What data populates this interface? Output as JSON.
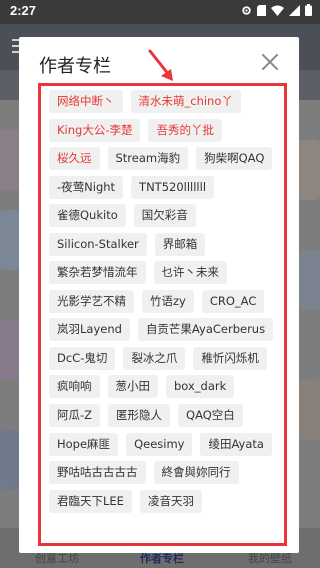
{
  "status_bar": {
    "time": "2:27"
  },
  "background": {
    "bottom_nav": [
      "创意工坊",
      "作者专栏",
      "我的壁纸"
    ],
    "active_nav": 1
  },
  "dialog": {
    "title": "作者专栏",
    "close_icon": "close-icon"
  },
  "annotation": {
    "color": "#e8343a"
  },
  "authors": [
    [
      {
        "name": "网络中断丶",
        "highlight": true
      },
      {
        "name": "清水未萌_chino丫",
        "highlight": true
      }
    ],
    [
      {
        "name": "King大公-李楚",
        "highlight": true
      },
      {
        "name": "吾秀的丫批",
        "highlight": true
      }
    ],
    [
      {
        "name": "桜久远",
        "highlight": true
      },
      {
        "name": "Stream海豹",
        "highlight": false
      },
      {
        "name": "狗柴啊QAQ",
        "highlight": false
      }
    ],
    [
      {
        "name": "-夜莺Night",
        "highlight": false
      },
      {
        "name": "TNT520lllllll",
        "highlight": false
      }
    ],
    [
      {
        "name": "雀德Qukito",
        "highlight": false
      },
      {
        "name": "国欠彩音",
        "highlight": false
      }
    ],
    [
      {
        "name": "Silicon-Stalker",
        "highlight": false
      },
      {
        "name": "界邮箱",
        "highlight": false
      }
    ],
    [
      {
        "name": "繁杂若梦惜流年",
        "highlight": false
      },
      {
        "name": "乜许丶未来",
        "highlight": false
      }
    ],
    [
      {
        "name": "光影学艺不精",
        "highlight": false
      },
      {
        "name": "竹语zy",
        "highlight": false
      },
      {
        "name": "CRO_AC",
        "highlight": false
      }
    ],
    [
      {
        "name": "岚羽Layend",
        "highlight": false
      },
      {
        "name": "自贡芒果AyaCerberus",
        "highlight": false
      }
    ],
    [
      {
        "name": "DcC-鬼切",
        "highlight": false
      },
      {
        "name": "裂冰之爪",
        "highlight": false
      },
      {
        "name": "稚忻闪烁机",
        "highlight": false
      }
    ],
    [
      {
        "name": "疯响响",
        "highlight": false
      },
      {
        "name": "葱小田",
        "highlight": false
      },
      {
        "name": "box_dark",
        "highlight": false
      }
    ],
    [
      {
        "name": "阿瓜-Z",
        "highlight": false
      },
      {
        "name": "匿形隐人",
        "highlight": false
      },
      {
        "name": "QAQ空白",
        "highlight": false
      }
    ],
    [
      {
        "name": "Hope麻匪",
        "highlight": false
      },
      {
        "name": "Qeesimy",
        "highlight": false
      },
      {
        "name": "绫田Ayata",
        "highlight": false
      }
    ],
    [
      {
        "name": "野咕咕古古古古",
        "highlight": false
      },
      {
        "name": "終會與妳同行",
        "highlight": false
      }
    ],
    [
      {
        "name": "君臨天下LEE",
        "highlight": false
      },
      {
        "name": "凌音天羽",
        "highlight": false
      }
    ]
  ]
}
